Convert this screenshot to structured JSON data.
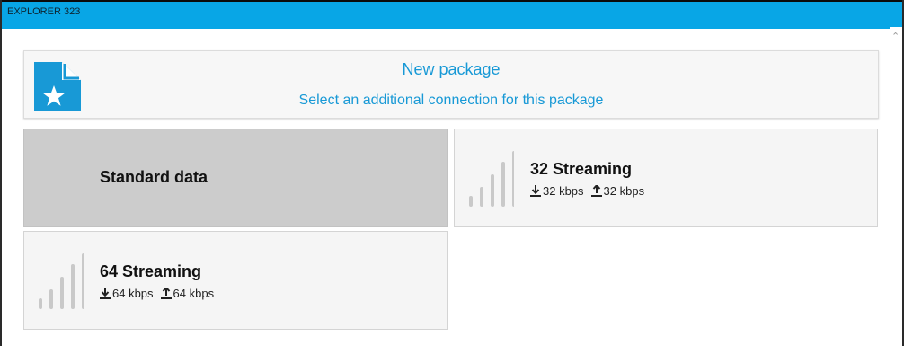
{
  "window": {
    "title": "EXPLORER 323"
  },
  "header": {
    "title": "New package",
    "subtitle": "Select an additional connection for this package",
    "icon": "new-document-star-icon"
  },
  "options": [
    {
      "id": "standard",
      "name": "Standard data",
      "selected": true
    },
    {
      "id": "32",
      "name": "32 Streaming",
      "download": "32 kbps",
      "upload": "32 kbps",
      "selected": false
    },
    {
      "id": "64",
      "name": "64 Streaming",
      "download": "64 kbps",
      "upload": "64 kbps",
      "selected": false
    }
  ],
  "colors": {
    "titlebar": "#08a6e6",
    "accent": "#1899d6",
    "selected_tile": "#cccccc",
    "signal_bars": "#c9c9c9"
  }
}
